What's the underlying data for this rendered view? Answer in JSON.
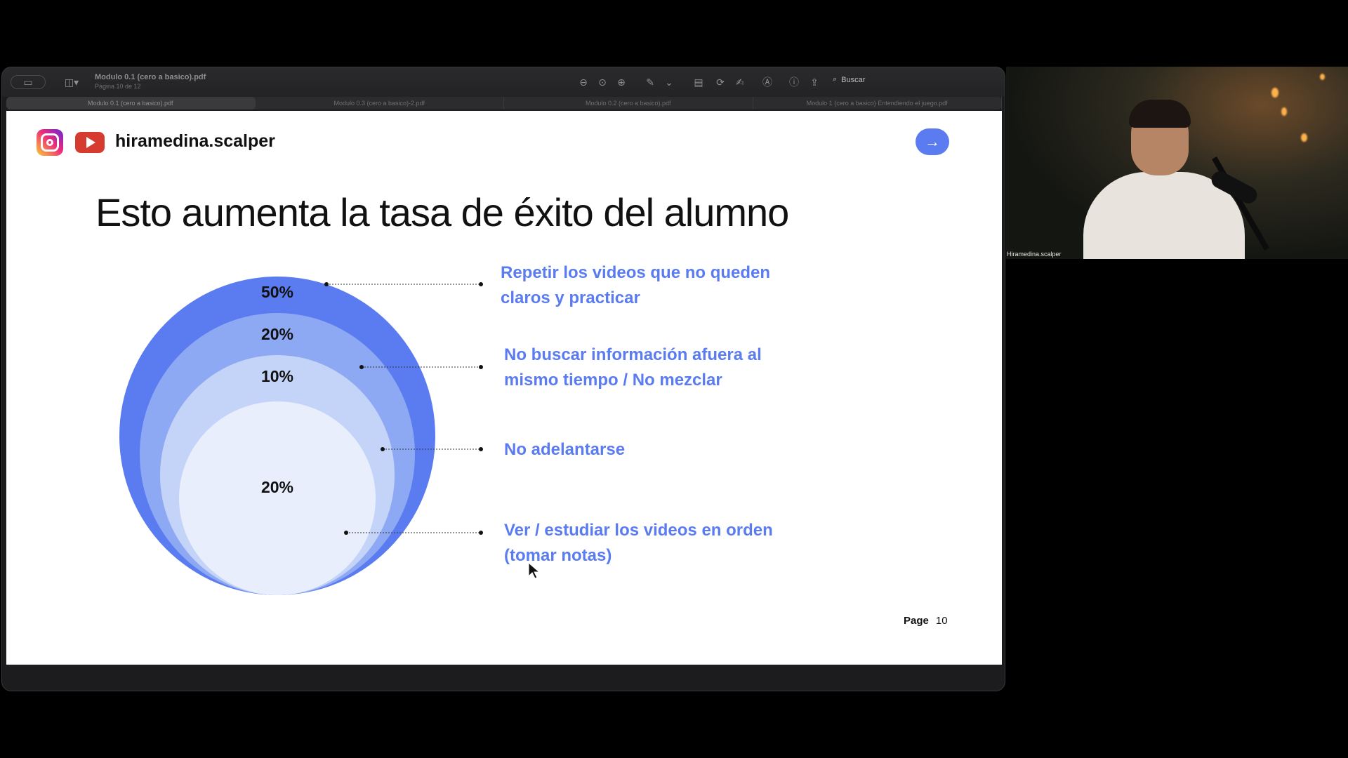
{
  "viewer": {
    "doc_title": "Modulo 0.1 (cero a basico).pdf",
    "page_indicator": "Página 10 de 12",
    "search_label": "Buscar",
    "tabs": [
      "Modulo 0.1 (cero a basico).pdf",
      "Modulo 0.3 (cero a basico)-2.pdf",
      "Modulo 0.2 (cero a basico).pdf",
      "Modulo 1 (cero a basico) Entendiendo el juego.pdf"
    ]
  },
  "slide": {
    "brand": "hiramedina.scalper",
    "title": "Esto aumenta la tasa de éxito del alumno",
    "circles": [
      {
        "label": "50%",
        "color": "#5b7cf0"
      },
      {
        "label": "20%",
        "color": "#8ea9f3"
      },
      {
        "label": "10%",
        "color": "#c4d3f8"
      },
      {
        "label": "20%",
        "color": "#e8eefc"
      }
    ],
    "items": [
      {
        "line1": "Repetir los videos que no queden",
        "line2": "claros y practicar"
      },
      {
        "line1": "No buscar información afuera al",
        "line2": "mismo tiempo / No mezclar"
      },
      {
        "line1": "No adelantarse",
        "line2": ""
      },
      {
        "line1": "Ver / estudiar  los videos en orden",
        "line2": "(tomar notas)"
      }
    ],
    "page_label": "Page",
    "page_number": "10",
    "accent_color": "#5b7cf0"
  },
  "webcam": {
    "participant_name": "Hiramedina.scalper"
  }
}
